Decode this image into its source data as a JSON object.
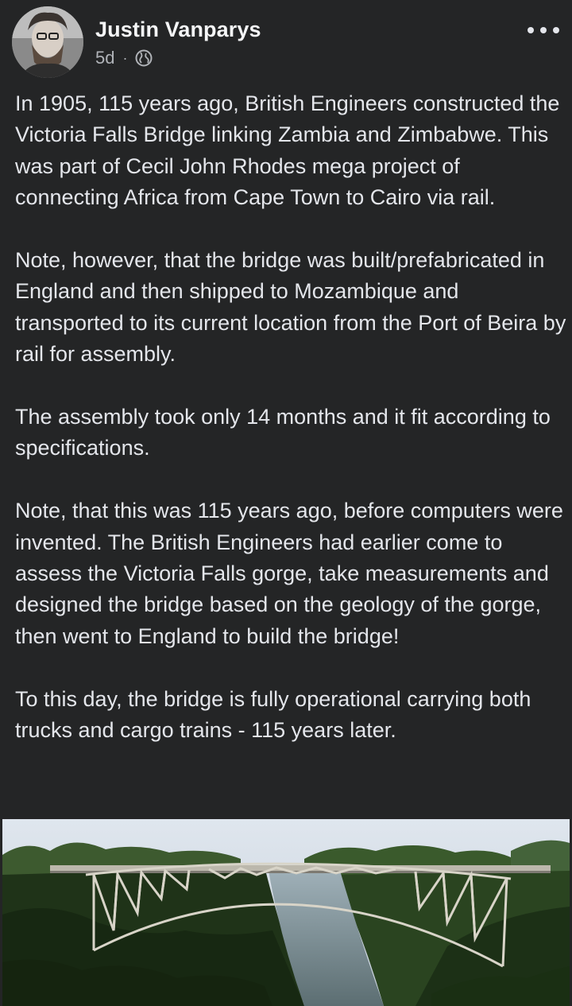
{
  "post": {
    "author": "Justin Vanparys",
    "time": "5d",
    "separator": "·",
    "audience_icon": "globe-icon",
    "more_icon": "more-options-icon",
    "paragraphs": [
      "In 1905, 115 years ago, British Engineers constructed the Victoria Falls Bridge linking Zambia and Zimbabwe. This was part of Cecil John Rhodes mega project of connecting Africa from Cape Town to Cairo via rail.",
      "Note, however, that the bridge was built/prefabricated in England and then shipped to Mozambique and transported to its current location from the Port of Beira by rail for assembly.",
      "The assembly took only 14 months and it fit according to specifications.",
      "Note, that this was 115 years ago, before computers were invented. The British Engineers had earlier come to assess the Victoria Falls gorge, take measurements and designed the bridge based on the geology of the gorge, then went to England to build the bridge!",
      "To this day, the bridge is fully operational carrying both trucks and cargo trains - 115 years later."
    ]
  },
  "colors": {
    "background": "#242526",
    "text": "#e4e6eb",
    "secondary_text": "#b0b3b8"
  }
}
